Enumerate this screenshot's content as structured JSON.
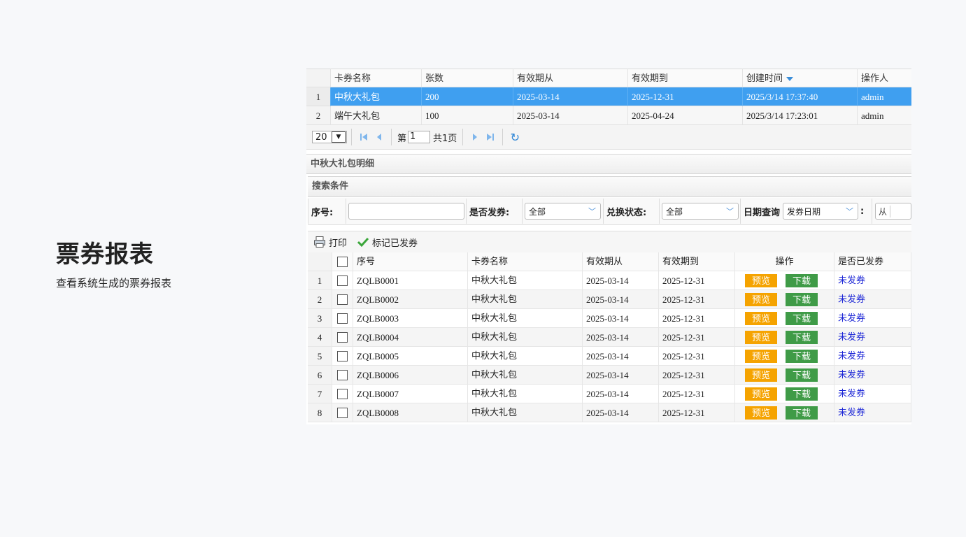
{
  "page": {
    "title": "票券报表",
    "subtitle": "查看系统生成的票券报表"
  },
  "top_grid": {
    "headers": [
      "卡券名称",
      "张数",
      "有效期从",
      "有效期到",
      "创建时间",
      "操作人"
    ],
    "rows": [
      {
        "no": "1",
        "name": "中秋大礼包",
        "count": "200",
        "from": "2025-03-14",
        "to": "2025-12-31",
        "created": "2025/3/14 17:37:40",
        "operator": "admin",
        "selected": true
      },
      {
        "no": "2",
        "name": "端午大礼包",
        "count": "100",
        "from": "2025-03-14",
        "to": "2025-04-24",
        "created": "2025/3/14 17:23:01",
        "operator": "admin",
        "selected": false
      }
    ]
  },
  "pager": {
    "page_size": "20",
    "page_prefix": "第",
    "page_value": "1",
    "total_text": "共1页"
  },
  "detail": {
    "panel_title": "中秋大礼包明细",
    "search_title": "搜索条件",
    "filters": {
      "serial_label": "序号:",
      "issued_label": "是否发券:",
      "issued_value": "全部",
      "exchange_label": "兑换状态:",
      "exchange_value": "全部",
      "date_label": "日期查询",
      "date_type_value": "发券日期",
      "colon": ":",
      "from_label": "从"
    },
    "toolbar": {
      "print_label": "打印",
      "mark_label": "标记已发券"
    },
    "headers": [
      "序号",
      "卡券名称",
      "有效期从",
      "有效期到",
      "操作",
      "是否已发券"
    ],
    "preview_label": "预览",
    "download_label": "下载",
    "rows": [
      {
        "no": "1",
        "serial": "ZQLB0001",
        "name": "中秋大礼包",
        "from": "2025-03-14",
        "to": "2025-12-31",
        "status": "未发券"
      },
      {
        "no": "2",
        "serial": "ZQLB0002",
        "name": "中秋大礼包",
        "from": "2025-03-14",
        "to": "2025-12-31",
        "status": "未发券"
      },
      {
        "no": "3",
        "serial": "ZQLB0003",
        "name": "中秋大礼包",
        "from": "2025-03-14",
        "to": "2025-12-31",
        "status": "未发券"
      },
      {
        "no": "4",
        "serial": "ZQLB0004",
        "name": "中秋大礼包",
        "from": "2025-03-14",
        "to": "2025-12-31",
        "status": "未发券"
      },
      {
        "no": "5",
        "serial": "ZQLB0005",
        "name": "中秋大礼包",
        "from": "2025-03-14",
        "to": "2025-12-31",
        "status": "未发券"
      },
      {
        "no": "6",
        "serial": "ZQLB0006",
        "name": "中秋大礼包",
        "from": "2025-03-14",
        "to": "2025-12-31",
        "status": "未发券"
      },
      {
        "no": "7",
        "serial": "ZQLB0007",
        "name": "中秋大礼包",
        "from": "2025-03-14",
        "to": "2025-12-31",
        "status": "未发券"
      },
      {
        "no": "8",
        "serial": "ZQLB0008",
        "name": "中秋大礼包",
        "from": "2025-03-14",
        "to": "2025-12-31",
        "status": "未发券"
      }
    ]
  },
  "colors": {
    "selected_row": "#3f9ff0",
    "preview_button": "#f5a300",
    "download_button": "#3f9b47",
    "status_link": "#1b25d6"
  }
}
